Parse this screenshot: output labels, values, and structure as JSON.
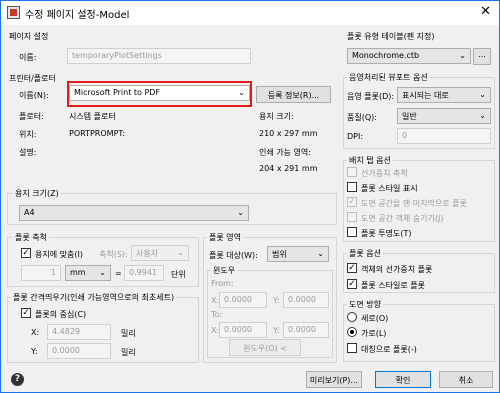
{
  "window": {
    "title": "수정 페이지 설정-Model",
    "close": "✕"
  },
  "page_setup": {
    "title": "페이지 설정",
    "name_label": "이름:",
    "name_value": "temporaryPlotSettings"
  },
  "printer": {
    "title": "프린터/플로터",
    "name_label": "이름(N):",
    "name_value": "Microsoft Print to PDF",
    "properties_button": "등록 정보(R)...",
    "plotter_label": "플로터:",
    "plotter_value": "시스템 플로터",
    "where_label": "위치:",
    "where_value": "PORTPROMPT:",
    "desc_label": "설명:",
    "paper_size_label": "용지 크기:",
    "paper_size_value": "210 x 297 mm",
    "printable_label": "인쇄 가능 영역:",
    "printable_value": "204 x 291 mm"
  },
  "paper_size": {
    "title": "용지 크기(Z)",
    "value": "A4"
  },
  "plot_scale": {
    "title": "플롯 축척",
    "fit_label": "용지에 맞춤(I)",
    "fit_checked": "✓",
    "scale_label": "축척(S):",
    "scale_value": "사용자",
    "qty1": "1",
    "unit": "mm",
    "equals": "=",
    "qty2": "0.9941",
    "units_label": "단위"
  },
  "plot_offset": {
    "title": "플롯 간격띄우기(인쇄 가능영역으로의 최초세트)",
    "center_label": "플롯의 중심(C)",
    "center_checked": "✓",
    "x_label": "X:",
    "x_value": "4.4829",
    "x_unit": "밀리",
    "y_label": "Y:",
    "y_value": "0.0000",
    "y_unit": "밀리"
  },
  "plot_area": {
    "title": "플롯 영역",
    "what_label": "플롯 대상(W):",
    "what_value": "범위",
    "window_title": "윈도우",
    "from_label": "From:",
    "to_label": "To:",
    "x_label": "X:",
    "y_label": "Y:",
    "from_x": "0.0000",
    "from_y": "0.0000",
    "to_x": "0.0000",
    "to_y": "0.0000",
    "window_button": "윈도우(O) <"
  },
  "plot_style_table": {
    "title": "플롯 유형 테이블(펜 지정)",
    "value": "Monochrome.ctb",
    "edit_button": "..."
  },
  "shaded_viewport": {
    "title": "음영처리된 뷰포트 옵션",
    "shade_label": "음영 플롯(D):",
    "shade_value": "표시되는 대로",
    "quality_label": "품질(Q):",
    "quality_value": "일반",
    "dpi_label": "DPI:",
    "dpi_value": "0"
  },
  "layout_options": {
    "title": "배치 탭 옵션",
    "items": [
      "선가중치 축척",
      "플롯 스타일 표시",
      "도면 공간을 맨 마지막으로 플롯",
      "도면 공간 객체 숨기기(J)",
      "플롯 투명도(T)"
    ],
    "checks": [
      "",
      "",
      "✓",
      "",
      ""
    ]
  },
  "plot_options": {
    "title": "플롯 옵션",
    "items": [
      "객체의 선가중치 플롯",
      "플롯 스타일로 플롯"
    ],
    "checks": [
      "✓",
      "✓"
    ]
  },
  "orientation": {
    "title": "도면 방향",
    "portrait": "세로(O)",
    "landscape": "가로(L)",
    "upside_down": "대칭으로 플롯(-)"
  },
  "footer": {
    "help": "?",
    "preview": "미리보기(P)...",
    "ok": "확인",
    "cancel": "취소"
  }
}
